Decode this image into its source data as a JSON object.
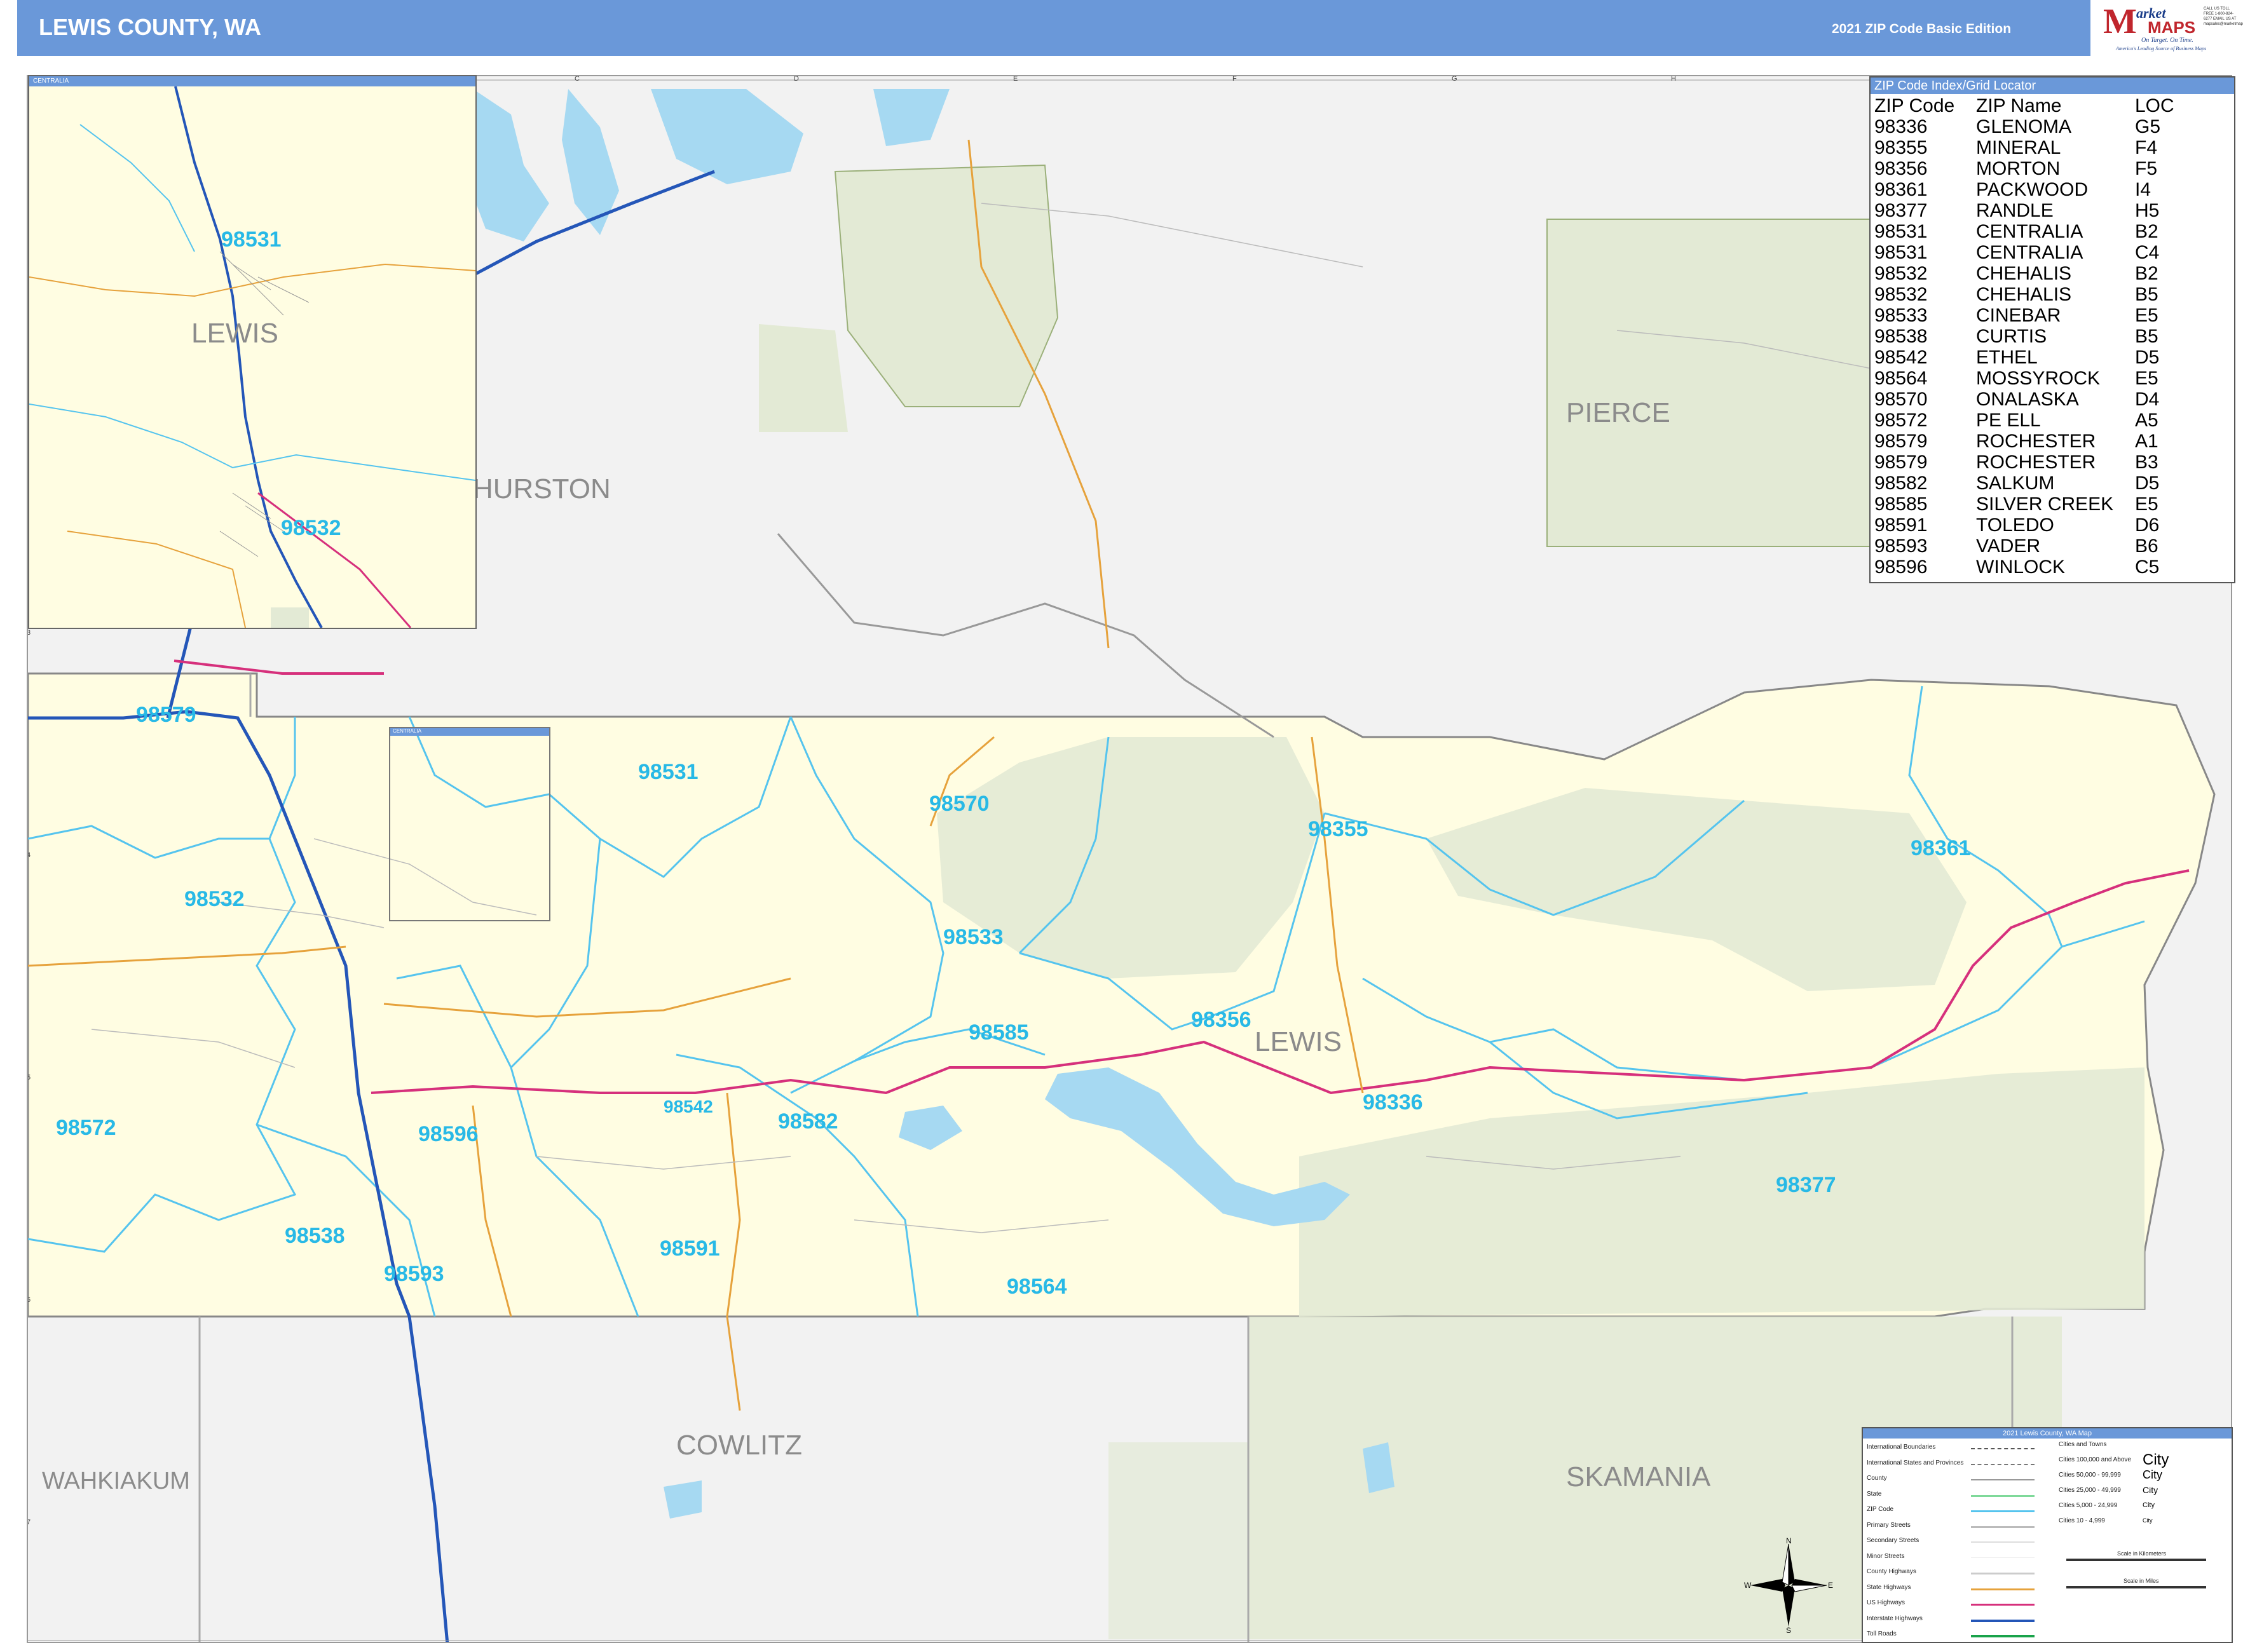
{
  "header": {
    "title": "LEWIS COUNTY, WA",
    "edition": "2021 ZIP Code Basic Edition",
    "logo": {
      "brand_first": "M",
      "brand_rest": "arket",
      "brand_second": "MAPS",
      "tagline": "On Target. On Time.",
      "subtitle": "America's Leading Source of Business Maps",
      "contact": "CALL US TOLL FREE 1-800-824-6277 EMAIL US AT mapsales@marketmaps.com"
    }
  },
  "colors": {
    "header_bg": "#6a98d9",
    "county_fill": "#fffde2",
    "forest_fill": "#e3ead5",
    "water": "#a6d9f2",
    "neighbor_fill": "#f2f2f2",
    "zip_label": "#28b9e6",
    "zip_boundary": "#55c4ee",
    "interstate": "#2456b8",
    "us_highway": "#d6307c",
    "state_highway": "#e6a23c"
  },
  "grid": {
    "columns": [
      "A",
      "B",
      "C",
      "D",
      "E",
      "F",
      "G",
      "H",
      "I",
      "J"
    ],
    "rows": [
      "1",
      "2",
      "3",
      "4",
      "5",
      "6",
      "7"
    ]
  },
  "regions": {
    "lewis": "LEWIS",
    "pierce": "PIERCE",
    "thurston": "HURSTON",
    "cowlitz": "COWLITZ",
    "wahkiakum": "WAHKIAKUM",
    "skamania": "SKAMANIA"
  },
  "zip_labels": {
    "z98579": "98579",
    "z98531": "98531",
    "z98570": "98570",
    "z98355": "98355",
    "z98361": "98361",
    "z98532": "98532",
    "z98533": "98533",
    "z98585": "98585",
    "z98356": "98356",
    "z98336": "98336",
    "z98572": "98572",
    "z98596": "98596",
    "z98542": "98542",
    "z98582": "98582",
    "z98377": "98377",
    "z98538": "98538",
    "z98593": "98593",
    "z98591": "98591",
    "z98564": "98564"
  },
  "inset": {
    "tab_label": "CENTRALIA",
    "region": "LEWIS",
    "zip_top": "98531",
    "zip_bottom": "98532"
  },
  "small_tab": {
    "label": "CENTRALIA"
  },
  "zip_index": {
    "title": "ZIP Code Index/Grid Locator",
    "headers": [
      "ZIP Code",
      "ZIP Name",
      "LOC"
    ],
    "rows": [
      [
        "98336",
        "GLENOMA",
        "G5"
      ],
      [
        "98355",
        "MINERAL",
        "F4"
      ],
      [
        "98356",
        "MORTON",
        "F5"
      ],
      [
        "98361",
        "PACKWOOD",
        "I4"
      ],
      [
        "98377",
        "RANDLE",
        "H5"
      ],
      [
        "98531",
        "CENTRALIA",
        "B2"
      ],
      [
        "98531",
        "CENTRALIA",
        "C4"
      ],
      [
        "98532",
        "CHEHALIS",
        "B2"
      ],
      [
        "98532",
        "CHEHALIS",
        "B5"
      ],
      [
        "98533",
        "CINEBAR",
        "E5"
      ],
      [
        "98538",
        "CURTIS",
        "B5"
      ],
      [
        "98542",
        "ETHEL",
        "D5"
      ],
      [
        "98564",
        "MOSSYROCK",
        "E5"
      ],
      [
        "98570",
        "ONALASKA",
        "D4"
      ],
      [
        "98572",
        "PE ELL",
        "A5"
      ],
      [
        "98579",
        "ROCHESTER",
        "A1"
      ],
      [
        "98579",
        "ROCHESTER",
        "B3"
      ],
      [
        "98582",
        "SALKUM",
        "D5"
      ],
      [
        "98585",
        "SILVER CREEK",
        "E5"
      ],
      [
        "98591",
        "TOLEDO",
        "D6"
      ],
      [
        "98593",
        "VADER",
        "B6"
      ],
      [
        "98596",
        "WINLOCK",
        "C5"
      ]
    ]
  },
  "legend": {
    "title": "2021 Lewis County, WA Map",
    "lines": [
      "International Boundaries",
      "International States and Provinces",
      "County",
      "State",
      "ZIP Code",
      "Primary Streets",
      "Secondary Streets",
      "Minor Streets",
      "County Highways",
      "State Highways",
      "US Highways",
      "Interstate Highways",
      "Toll Roads"
    ],
    "cities_header": "Cities and Towns",
    "cities": [
      {
        "label": "Cities 100,000 and Above",
        "sample": "City"
      },
      {
        "label": "Cities 50,000 - 99,999",
        "sample": "City"
      },
      {
        "label": "Cities 25,000 - 49,999",
        "sample": "City"
      },
      {
        "label": "Cities 5,000 - 24,999",
        "sample": "City"
      },
      {
        "label": "Cities 10 - 4,999",
        "sample": "City"
      }
    ],
    "scale_km": "Scale in Kilometers",
    "scale_mi": "Scale in Miles"
  },
  "compass": {
    "n": "N",
    "s": "S",
    "e": "E",
    "w": "W"
  }
}
